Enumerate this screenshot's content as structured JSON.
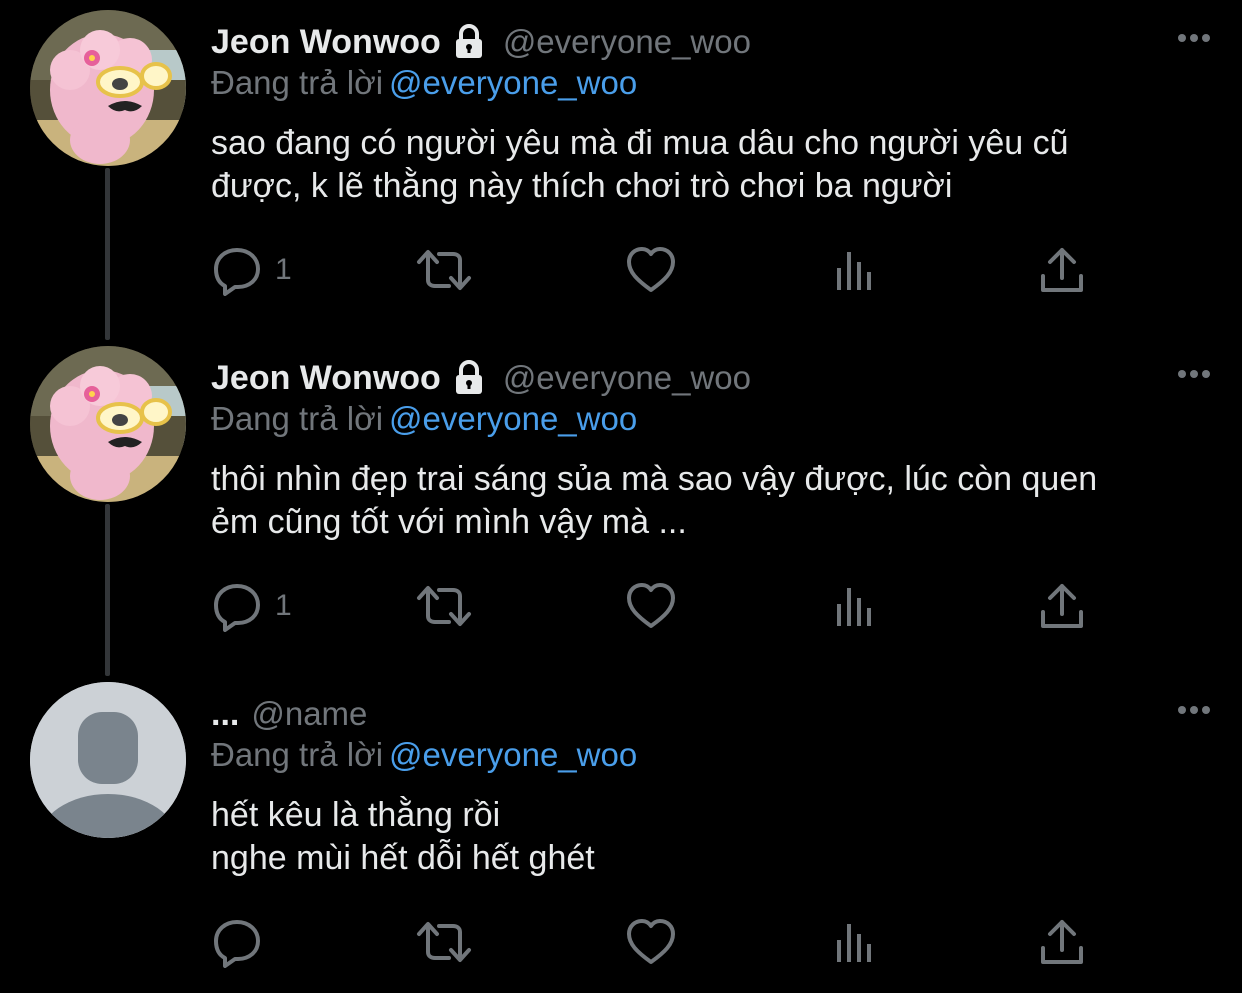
{
  "colors": {
    "background": "#000000",
    "text": "#e7e9ea",
    "muted": "#71767b",
    "mention": "#4a9eea",
    "thread_line": "#333639"
  },
  "icons": {
    "lock": "lock-icon",
    "more": "more-horizontal-icon",
    "reply": "reply-bubble-icon",
    "retweet": "retweet-icon",
    "like": "heart-icon",
    "views": "bar-chart-icon",
    "share": "share-upload-icon"
  },
  "tweets": [
    {
      "display_name": "Jeon Wonwoo",
      "handle": "@everyone_woo",
      "replying_label": "Đang trả lời",
      "replying_to": "@everyone_woo",
      "text_lines": [
        "sao đang có người yêu mà đi mua dâu cho người yêu cũ",
        "được, k lẽ thằng này thích chơi trò chơi ba người"
      ],
      "reply_count": "1"
    },
    {
      "display_name": "Jeon Wonwoo",
      "handle": "@everyone_woo",
      "replying_label": "Đang trả lời",
      "replying_to": "@everyone_woo",
      "text_lines": [
        "thôi nhìn đẹp trai sáng sủa mà sao vậy được, lúc còn quen",
        "ẻm cũng tốt với mình vậy mà ..."
      ],
      "reply_count": "1"
    },
    {
      "display_name": "...",
      "handle": "@name",
      "replying_label": "Đang trả lời",
      "replying_to": "@everyone_woo",
      "text_lines": [
        "hết kêu là thằng rồi",
        "nghe mùi hết dỗi hết ghét"
      ],
      "reply_count": ""
    }
  ]
}
